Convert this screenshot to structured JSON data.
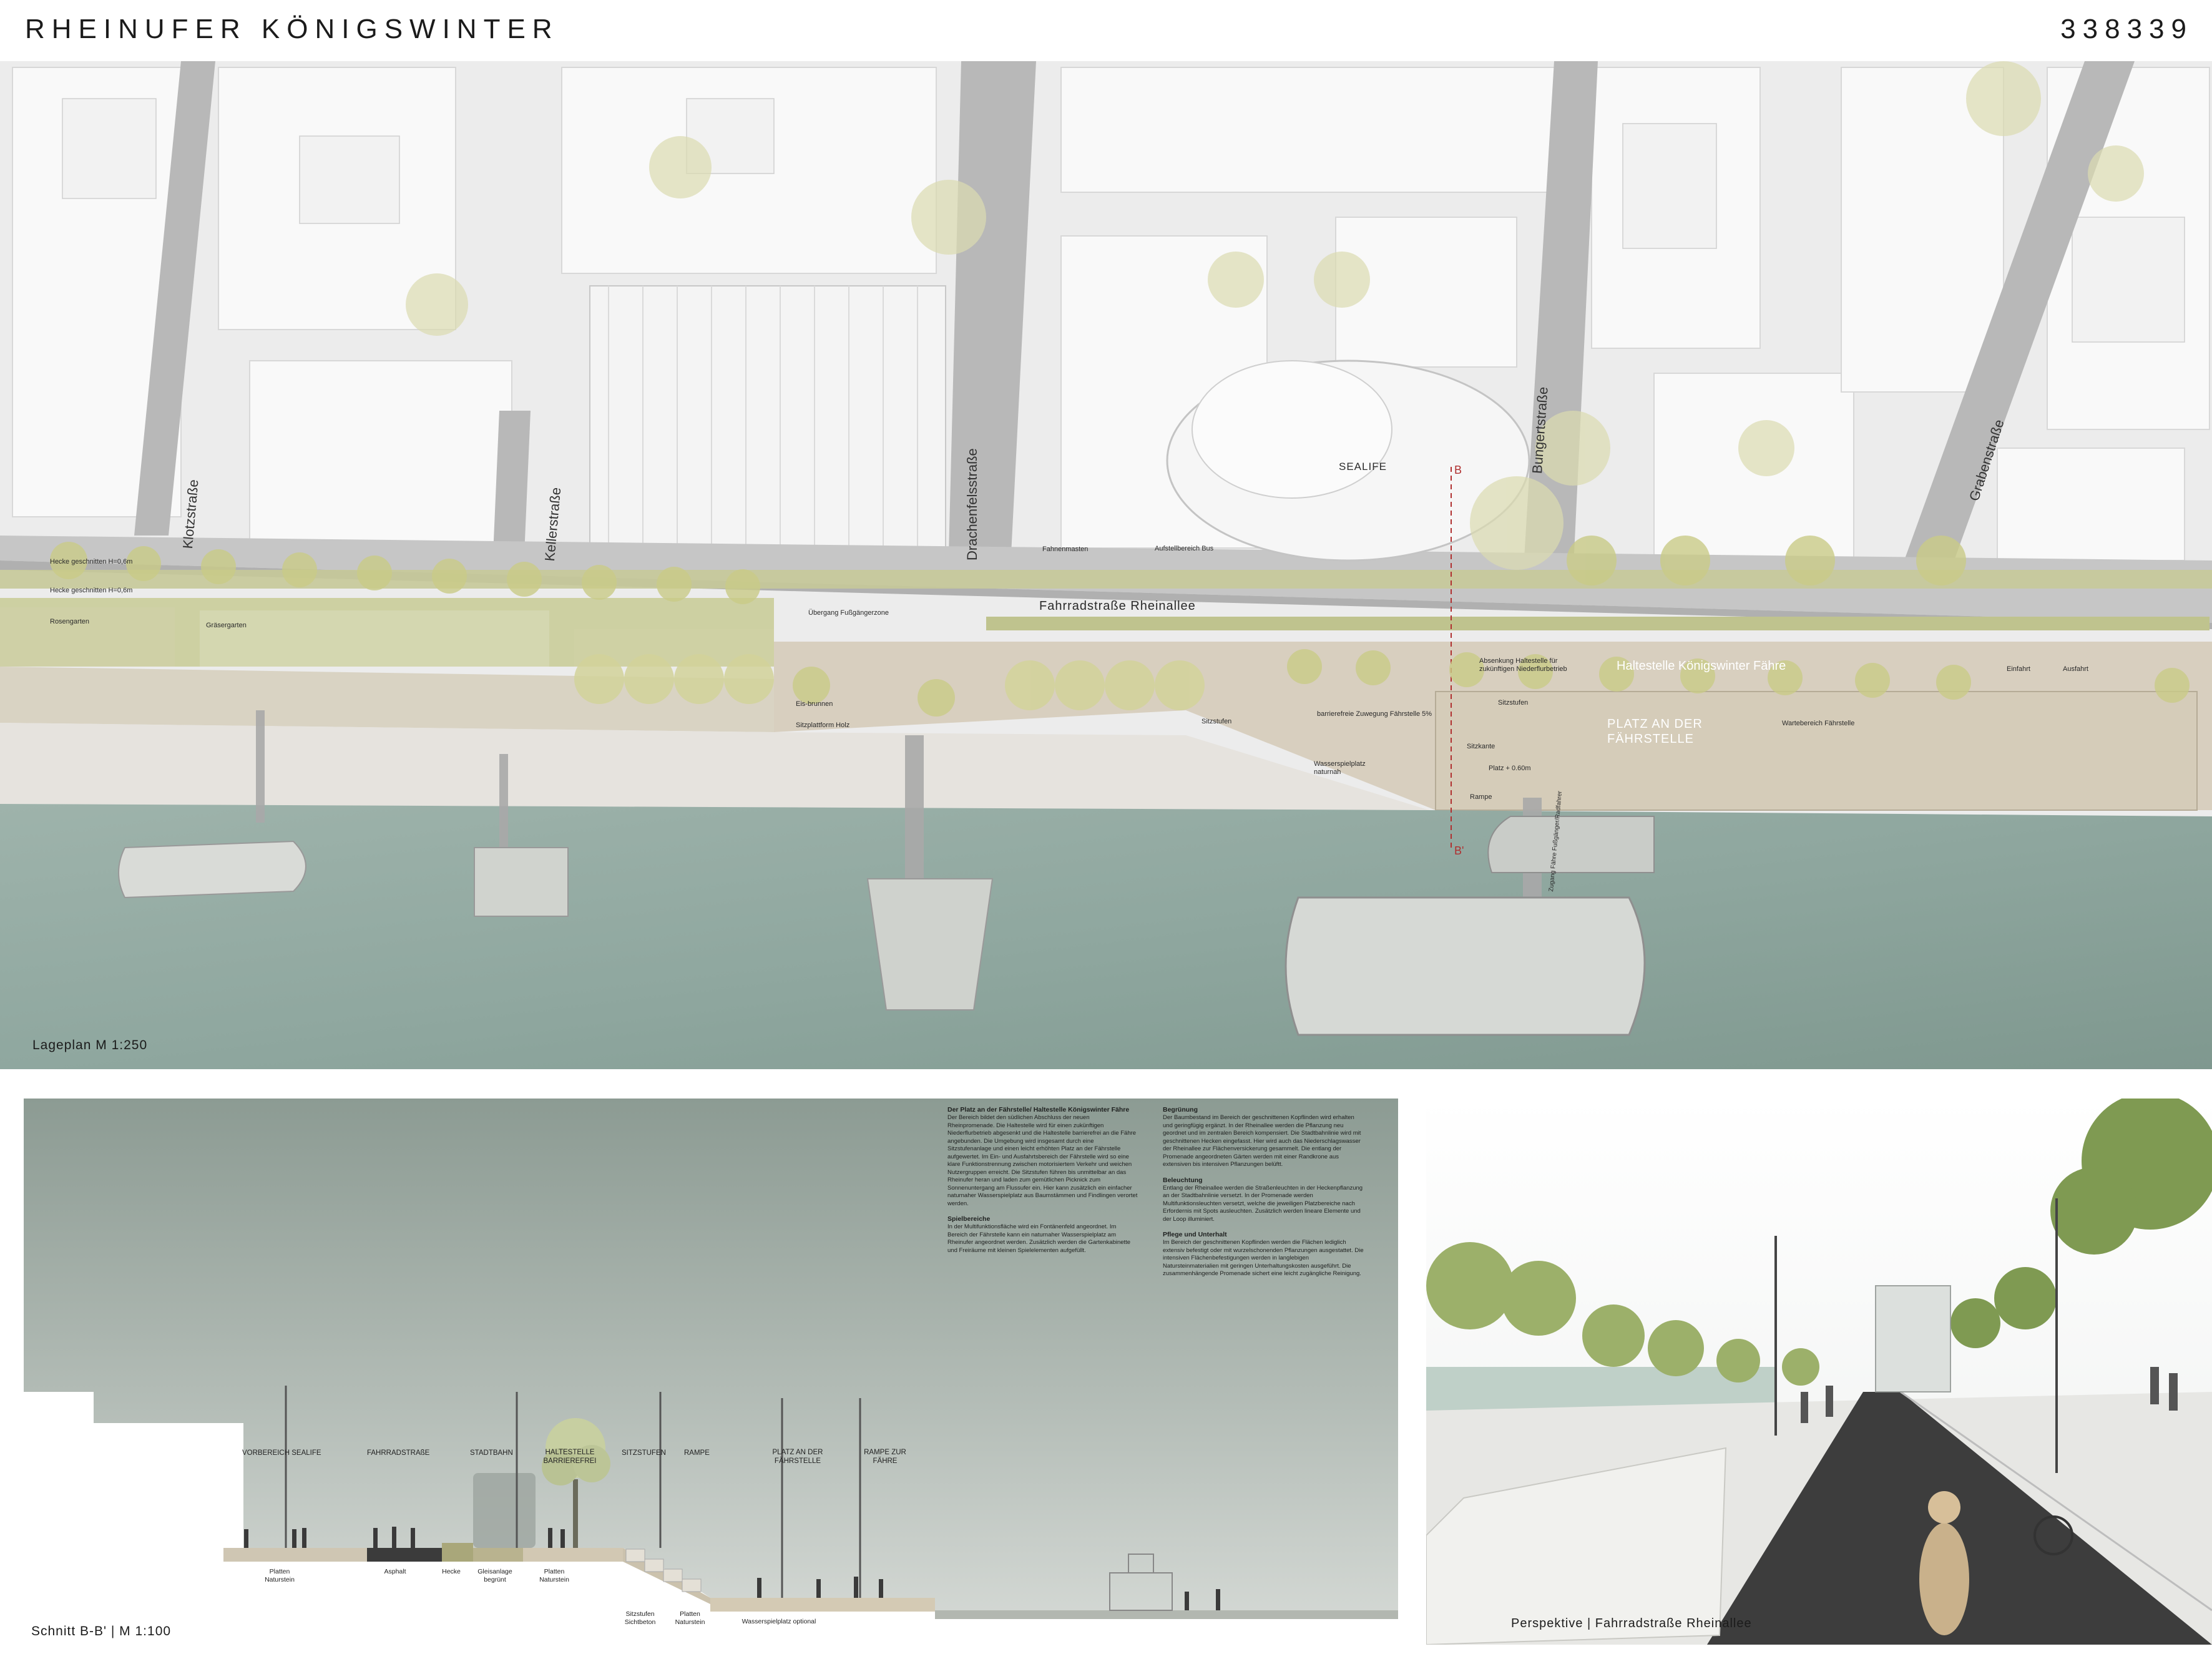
{
  "header": {
    "title": "RHEINUFER KÖNIGSWINTER",
    "code": "338339"
  },
  "plan": {
    "caption": "Lageplan M 1:250",
    "streets": {
      "klotz": "Klotzstraße",
      "keller": "Kellerstraße",
      "drachen": "Drachenfelsstraße",
      "bunger": "Bungertstraße",
      "graben": "Grabenstraße"
    },
    "labels": {
      "sealife": "SEALIFE",
      "b_top": "B",
      "b_bottom": "B'",
      "hecke1": "Hecke geschnitten H=0,6m",
      "hecke2": "Hecke geschnitten H=0,6m",
      "rosengarten": "Rosengarten",
      "graeser": "Gräsergarten",
      "uebergang": "Übergang Fußgängerzone",
      "fahrrad": "Fahrradstraße Rheinallee",
      "fahnen": "Fahnenmasten",
      "aufstell": "Aufstellbereich Bus",
      "eisbrunnen": "Eis-brunnen",
      "sitzplattform": "Sitzplattform Holz",
      "sitzstufen1": "Sitzstufen",
      "barrierefrei": "barrierefreie Zuwegung Fährstelle 5%",
      "sitzstufen2": "Sitzstufen",
      "sitzkante": "Sitzkante",
      "platz": "Platz + 0.60m",
      "rampe": "Rampe",
      "wasserspiel": "Wasserspielplatz naturnah",
      "absenkung": "Absenkung Haltestelle für zukünftigen Niederflurbetrieb",
      "haltestelle": "Haltestelle Königswinter Fähre",
      "platz_title": "PLATZ AN DER FÄHRSTELLE",
      "warte": "Wartebereich Fährstelle",
      "einfahrt": "Einfahrt",
      "ausfahrt": "Ausfahrt",
      "zugang": "Zugang Fähre Fußgänger/Radfahrer"
    }
  },
  "section": {
    "caption": "Schnitt B-B' | M 1:100",
    "top_labels": [
      "VORBEREICH SEALIFE",
      "FAHRRADSTRAßE",
      "STADTBAHN",
      "HALTESTELLE BARRIEREFREI",
      "SITZSTUFEN",
      "RAMPE",
      "PLATZ AN DER FÄHRSTELLE",
      "RAMPE ZUR FÄHRE"
    ],
    "bottom_labels": [
      "Platten Naturstein",
      "Asphalt",
      "Hecke",
      "Gleisanlage begrünt",
      "Platten Naturstein",
      "Sitzstufen Sichtbeton",
      "Platten Naturstein",
      "Wasserspielplatz optional"
    ],
    "text": {
      "c1_h1": "Der Platz an der Fährstelle/ Haltestelle Königswinter Fähre",
      "c1_p1": "Der Bereich bildet den südlichen Abschluss der neuen Rheinpromenade. Die Haltestelle wird für einen zukünftigen Niederflurbetrieb abgesenkt und die Haltestelle barrierefrei an die Fähre angebunden. Die Umgebung wird insgesamt durch eine Sitzstufenanlage und einen leicht erhöhten Platz an der Fährstelle aufgewertet. Im Ein- und Ausfahrtsbereich der Fährstelle wird so eine klare Funktionstrennung zwischen motorisiertem Verkehr und weichen Nutzergruppen erreicht. Die Sitzstufen führen bis unmittelbar an das Rheinufer heran und laden zum gemütlichen Picknick zum Sonnenuntergang am Flussufer ein. Hier kann zusätzlich ein einfacher naturnaher Wasserspielplatz aus Baumstämmen und Findlingen verortet werden.",
      "c1_h2": "Spielbereiche",
      "c1_p2": "In der Multifunktionsfläche wird ein Fontänenfeld angeordnet. Im Bereich der Fährstelle kann ein naturnaher Wasserspielplatz am Rheinufer angeordnet werden. Zusätzlich werden die Gartenkabinette und Freiräume mit kleinen Spielelementen aufgefüllt.",
      "c2_h1": "Begrünung",
      "c2_p1": "Der Baumbestand im Bereich der geschnittenen Kopflinden wird erhalten und geringfügig ergänzt. In der Rheinallee werden die Pflanzung neu geordnet und im zentralen Bereich kompensiert. Die Stadtbahnlinie wird mit geschnittenen Hecken eingefasst. Hier wird auch das Niederschlagswasser der Rheinallee zur Flächenversickerung gesammelt. Die entlang der Promenade angeordneten Gärten werden mit einer Randkrone aus extensiven bis intensiven Pflanzungen belüftt.",
      "c2_h2": "Beleuchtung",
      "c2_p2": "Entlang der Rheinallee werden die Straßenleuchten in der Heckenpflanzung an der Stadtbahnlinie versetzt. In der Promenade werden Multifunktionsleuchten versetzt, welche die jeweiligen Platzbereiche nach Erfordernis mit Spots ausleuchten. Zusätzlich werden lineare Elemente und der Loop illuminiert.",
      "c2_h3": "Pflege und Unterhalt",
      "c2_p3": "Im Bereich der geschnittenen Kopflinden werden die Flächen lediglich extensiv befestigt oder mit wurzelschonenden Pflanzungen ausgestattet. Die intensiven Flächenbefestigungen werden in langlebigen Natursteinmaterialien mit geringen Unterhaltungskosten ausgeführt. Die zusammenhängende Promenade sichert eine leicht zugängliche Reinigung."
    }
  },
  "perspective": {
    "caption": "Perspektive | Fahrradstraße Rheinallee"
  }
}
